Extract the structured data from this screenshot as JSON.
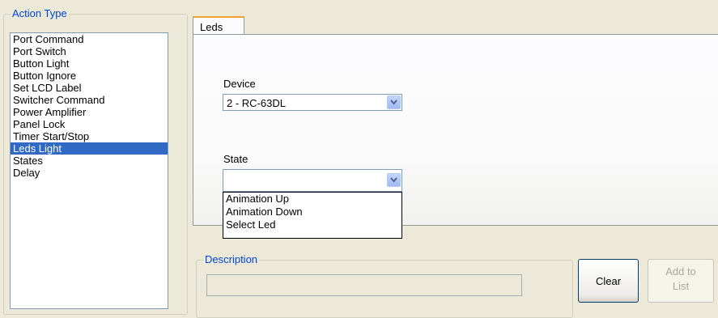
{
  "action_type": {
    "title": "Action Type",
    "items": [
      "Port Command",
      "Port Switch",
      "Button Light",
      "Button Ignore",
      "Set LCD Label",
      "Switcher Command",
      "Power Amplifier",
      "Panel Lock",
      "Timer Start/Stop",
      "Leds Light",
      "States",
      "Delay"
    ],
    "selected": "Leds Light"
  },
  "tab": {
    "label": "Leds"
  },
  "device": {
    "label": "Device",
    "value": "2 - RC-63DL"
  },
  "state": {
    "label": "State",
    "value": "",
    "options": [
      "Animation Up",
      "Animation Down",
      "Select Led"
    ]
  },
  "description": {
    "title": "Description",
    "value": ""
  },
  "buttons": {
    "clear": "Clear",
    "add_to_list": "Add to\nList"
  },
  "colors": {
    "accent": "#316ac5",
    "group_title": "#0046d5",
    "tab_highlight": "#f0a030"
  }
}
